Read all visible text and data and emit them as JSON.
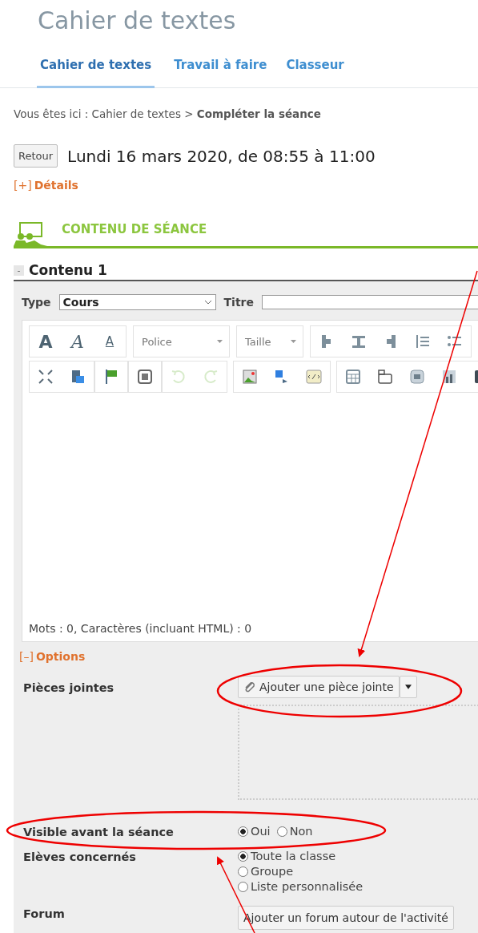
{
  "title": "Cahier de textes",
  "tabs": [
    {
      "label": "Cahier de textes",
      "selected": true
    },
    {
      "label": "Travail à faire",
      "selected": false
    },
    {
      "label": "Classeur",
      "selected": false
    }
  ],
  "breadcrumb": "Vous êtes ici : Cahier de textes > **Compléter la séance**",
  "back_button": "Retour",
  "session_date": "Lundi 16 mars 2020, de 08:55 à 11:00",
  "details_toggle": {
    "sign": "[+]",
    "label": "Détails"
  },
  "section_title": "CONTENU DE SÉANCE",
  "content": {
    "toggle": "-",
    "title": "Contenu 1",
    "type_label": "Type",
    "type_value": "Cours",
    "title_label": "Titre",
    "toolbar": [
      [
        [
          {
            "kind": "bold",
            "text": "A",
            "disabled": false
          },
          {
            "kind": "italic",
            "text": "A",
            "disabled": false
          },
          {
            "kind": "underline",
            "text": "A",
            "disabled": false
          }
        ],
        [
          {
            "kind": "select",
            "text": "Police",
            "disabled": false
          }
        ],
        [
          {
            "kind": "select",
            "text": "Taille",
            "disabled": false
          }
        ],
        [
          {
            "kind": "align-left",
            "disabled": false
          },
          {
            "kind": "align-center",
            "disabled": false
          },
          {
            "kind": "align-right",
            "disabled": false
          },
          {
            "kind": "numbered-list",
            "disabled": false
          },
          {
            "kind": "bullet-list",
            "disabled": false
          }
        ]
      ],
      [
        [
          {
            "kind": "fullscreen",
            "disabled": false
          },
          {
            "kind": "paste",
            "disabled": false
          }
        ],
        [
          {
            "kind": "flag",
            "disabled": false
          }
        ],
        [
          {
            "kind": "block",
            "disabled": false
          }
        ],
        [
          {
            "kind": "undo",
            "disabled": true
          },
          {
            "kind": "redo",
            "disabled": true
          }
        ],
        [
          {
            "kind": "image",
            "disabled": false
          },
          {
            "kind": "link",
            "disabled": false
          },
          {
            "kind": "code",
            "disabled": false
          }
        ],
        [
          {
            "kind": "table",
            "disabled": false
          },
          {
            "kind": "tabs",
            "disabled": false
          },
          {
            "kind": "widget",
            "disabled": false
          },
          {
            "kind": "chart",
            "disabled": false
          },
          {
            "kind": "media",
            "disabled": false
          }
        ]
      ]
    ],
    "word_count": "Mots : 0, Caractères (incluant HTML) : 0"
  },
  "options_toggle": {
    "sign": "[–]",
    "label": "Options"
  },
  "attachments": {
    "label": "Pièces jointes",
    "button": "Ajouter une pièce jointe"
  },
  "visible": {
    "label": "Visible avant la séance",
    "options": [
      {
        "label": "Oui",
        "selected": true
      },
      {
        "label": "Non",
        "selected": false
      }
    ]
  },
  "students": {
    "label": "Elèves concernés",
    "options": [
      {
        "label": "Toute la classe",
        "selected": true
      },
      {
        "label": "Groupe",
        "selected": false
      },
      {
        "label": "Liste personnalisée",
        "selected": false
      }
    ]
  },
  "forum": {
    "label": "Forum",
    "button": "Ajouter un forum autour de l'activité"
  }
}
